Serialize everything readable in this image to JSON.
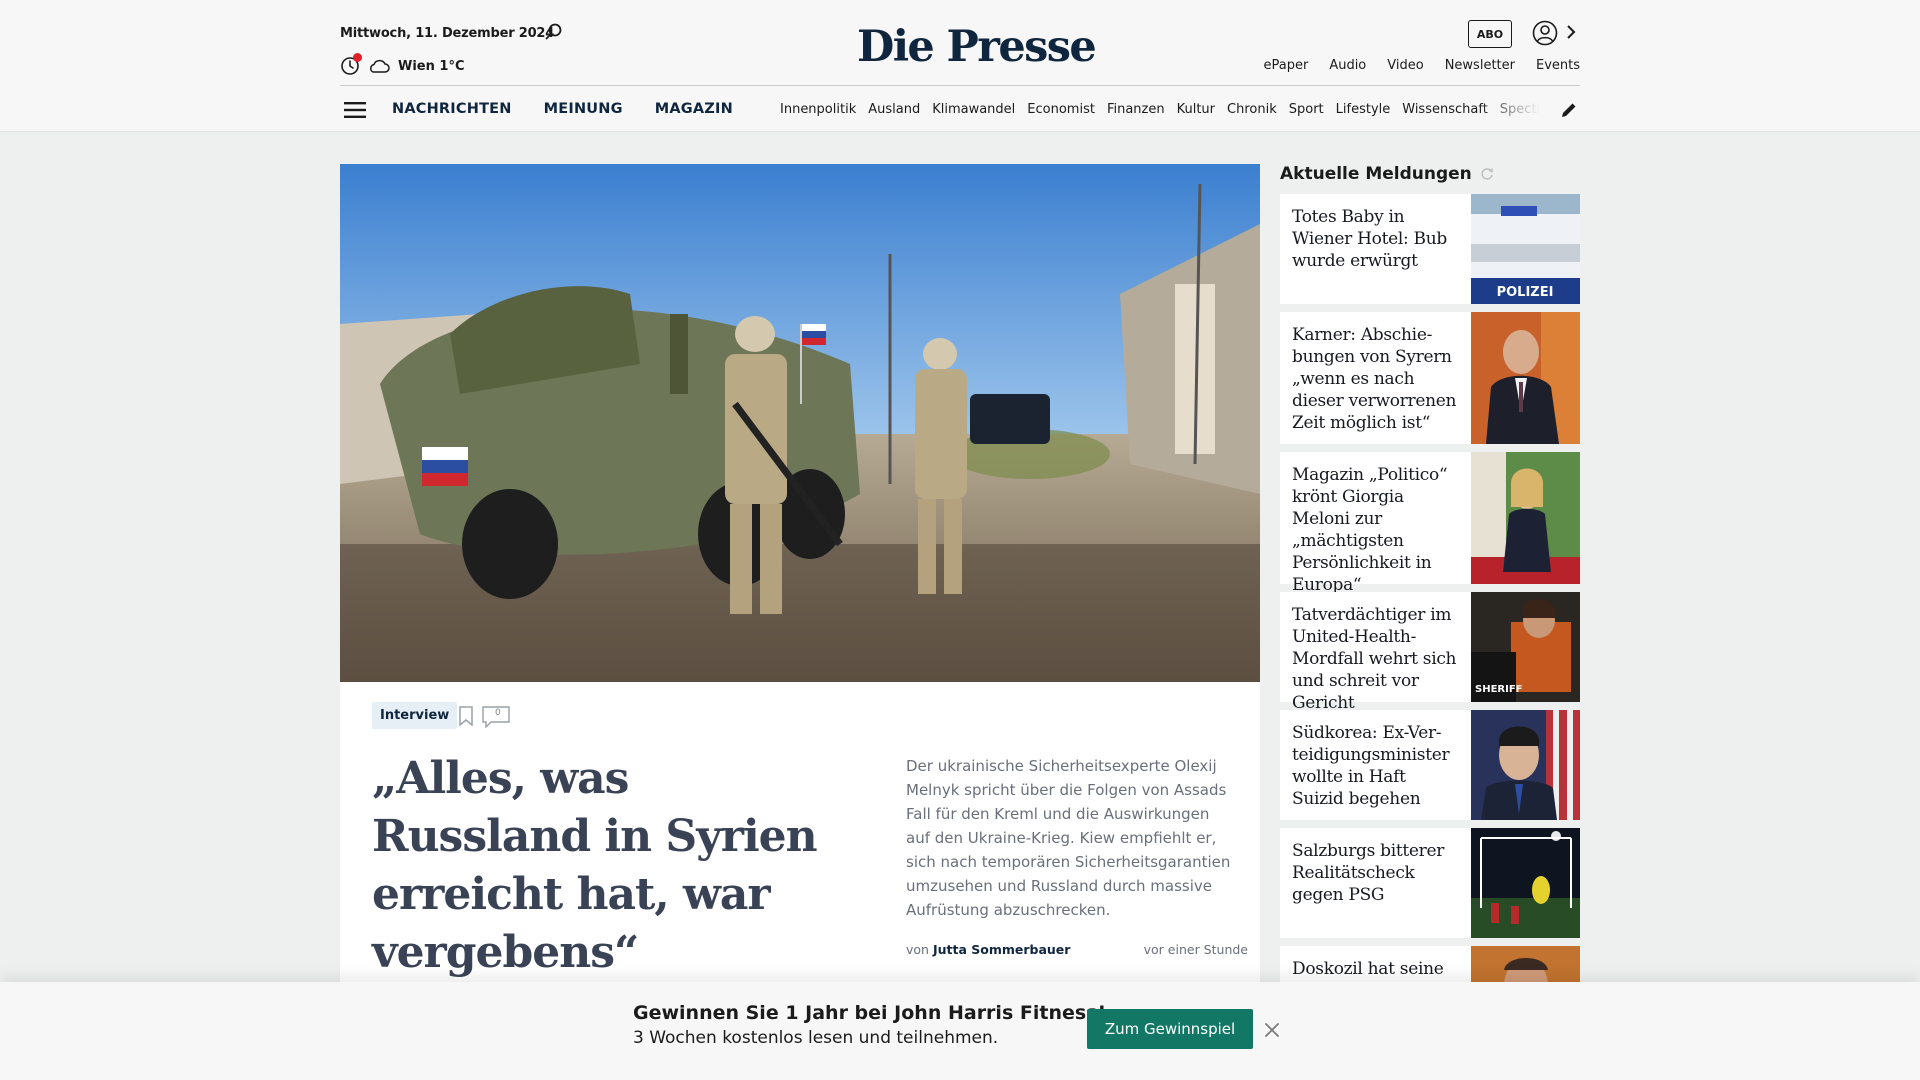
{
  "header": {
    "date": "Mittwoch, 11. Dezember 2024",
    "weather": "Wien 1°C",
    "logo": "Die Presse",
    "abo_label": "ABO",
    "top_links": [
      "ePaper",
      "Audio",
      "Video",
      "Newsletter",
      "Events"
    ],
    "main_nav": [
      "NACHRICHTEN",
      "MEINUNG",
      "MAGAZIN"
    ],
    "sub_nav": [
      "Innenpolitik",
      "Ausland",
      "Klimawandel",
      "Economist",
      "Finanzen",
      "Kultur",
      "Chronik",
      "Sport",
      "Lifestyle",
      "Wissenschaft",
      "Spectrum"
    ]
  },
  "lead": {
    "tag": "Interview",
    "comment_count": "0",
    "headline": "„Alles, was Russland in Syrien erreicht hat, war vergebens“",
    "teaser": "Der ukrainische Sicherheitsexperte Olexij Melnyk spricht über die Folgen von Assads Fall für den Kreml und die Auswirkungen auf den Ukraine-Krieg. Kiew empfiehlt er, sich nach temporären Sicherheitsgarantien umzusehen und Russland durch massive Aufrüstung abzuschrecken.",
    "byline_prefix": "von",
    "author": "Jutta Sommerbauer",
    "time": "vor einer Stunde"
  },
  "sidebar": {
    "title": "Aktuelle Meldungen",
    "items": [
      {
        "title": "Totes Baby in Wiener Hotel: Bub wurde erwürgt",
        "thumb_text": "POLIZEI"
      },
      {
        "title": "Karner: Abschie­bungen von Syrern „wenn es nach dieser verworrenen Zeit möglich ist“"
      },
      {
        "title": "Magazin „Politico“ krönt Giorgia Meloni zur „mächtigsten Persönlichkeit in Europa“"
      },
      {
        "title": "Tatverdächtiger im United-Health-Mord­fall wehrt sich und schreit vor Gericht",
        "thumb_text": "SHERIFF"
      },
      {
        "title": "Südkorea: Ex-Ver­teidigungsminister wollte in Haft Suizid begehen"
      },
      {
        "title": "Salzburgs bitterer Realitätscheck gegen PSG"
      },
      {
        "title": "Doskozil hat seine"
      }
    ]
  },
  "promo": {
    "title": "Gewinnen Sie 1 Jahr bei John Harris Fitness!",
    "subtitle": "3 Wochen kostenlos lesen und teilnehmen.",
    "button": "Zum Gewinnspiel"
  },
  "colors": {
    "brand_navy": "#10263e",
    "promo_green": "#137765",
    "alert_red": "#e0202a"
  }
}
